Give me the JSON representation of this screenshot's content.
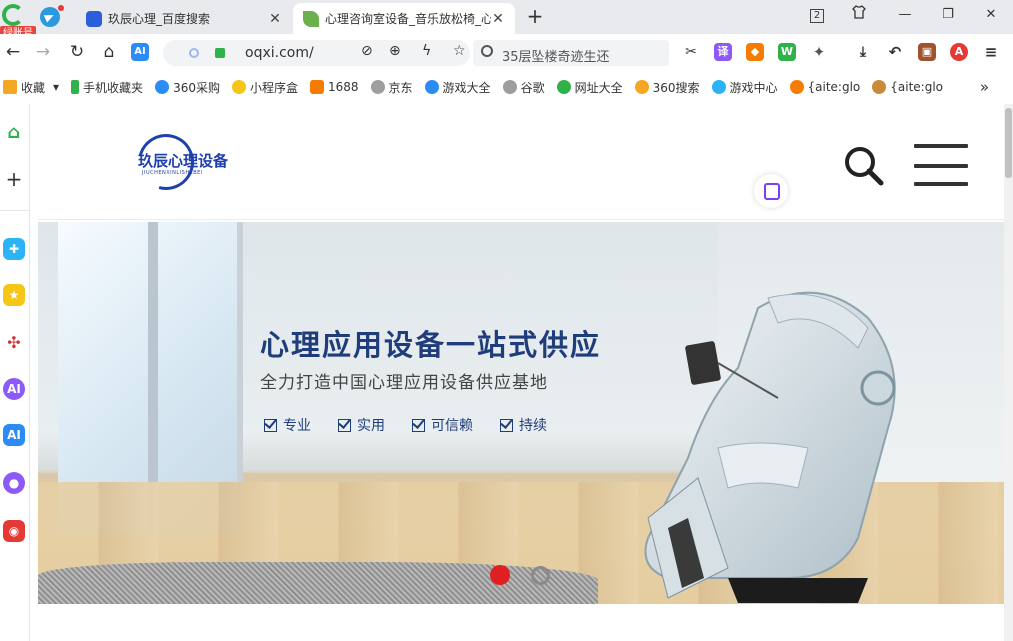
{
  "browser": {
    "account_tag": "绿账号",
    "tabs": [
      {
        "title": "玖辰心理_百度搜索",
        "active": false
      },
      {
        "title": "心理咨询室设备_音乐放松椅_心",
        "active": true
      }
    ],
    "new_tab_symbol": "+",
    "tab_count": "2",
    "url": "oqxi.com/",
    "search_placeholder": "35层坠楼奇迹生还",
    "ai_label": "AI"
  },
  "bookmarks": {
    "items": [
      {
        "label": "收藏",
        "color": "#f5a623"
      },
      {
        "label": "手机收藏夹",
        "color": "#2fb24a"
      },
      {
        "label": "360采购",
        "color": "#2b8cf5"
      },
      {
        "label": "小程序盒",
        "color": "#f5c518"
      },
      {
        "label": "1688",
        "color": "#f57c00"
      },
      {
        "label": "京东",
        "color": "#9e9e9e"
      },
      {
        "label": "游戏大全",
        "color": "#2b8cf5"
      },
      {
        "label": "谷歌",
        "color": "#9e9e9e"
      },
      {
        "label": "网址大全",
        "color": "#2fb24a"
      },
      {
        "label": "360搜索",
        "color": "#f5a623"
      },
      {
        "label": "游戏中心",
        "color": "#2bb3f5"
      },
      {
        "label": "{aite:glo",
        "color": "#f57c00"
      },
      {
        "label": "{aite:glo",
        "color": "#c98a3a"
      }
    ],
    "more": "»"
  },
  "site": {
    "logo_text": "玖辰心理设备",
    "logo_sub": "JIUCHENXINLISHEBEI",
    "banner": {
      "title": "心理应用设备一站式供应",
      "subtitle": "全力打造中国心理应用设备供应基地",
      "features": [
        "专业",
        "实用",
        "可信赖",
        "持续"
      ]
    },
    "carousel": {
      "active_index": 0,
      "count": 2
    }
  },
  "colors": {
    "accent": "#1f3d7a",
    "carousel_active": "#e02020",
    "tab_bg": "#e8eaed"
  }
}
